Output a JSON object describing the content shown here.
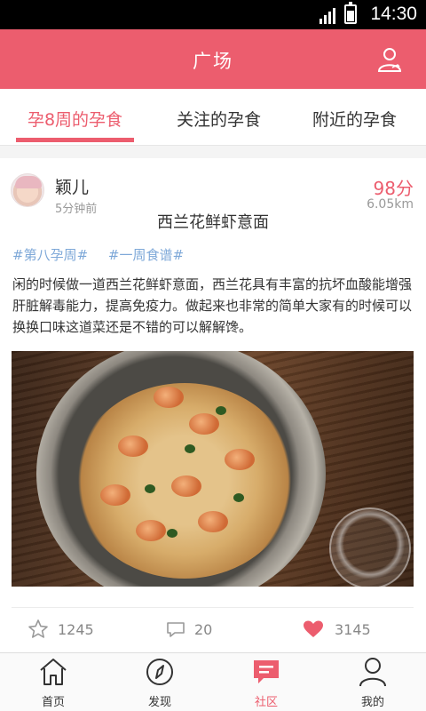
{
  "status_bar": {
    "time": "14:30",
    "icons": [
      "signal-icon",
      "battery-icon"
    ]
  },
  "app_bar": {
    "title": "广场",
    "icons": [
      "user-icon"
    ]
  },
  "tabs": [
    {
      "label": "孕8周的孕食",
      "active": true
    },
    {
      "label": "关注的孕食",
      "active": false
    },
    {
      "label": "附近的孕食",
      "active": false
    }
  ],
  "post": {
    "author": "颖儿",
    "time_ago": "5分钟前",
    "score": "98分",
    "distance": "6.05km",
    "title": "西兰花鲜虾意面",
    "tags": [
      "#第八孕周#",
      "#一周食谱#"
    ],
    "text": "闲的时候做一道西兰花鲜虾意面，西兰花具有丰富的抗坏血酸能增强肝脏解毒能力，提高免疫力。做起来也非常的简单大家有的时候可以换换口味这道菜还是不错的可以解解馋。",
    "image_alt": "shrimp-pasta-photo",
    "actions": {
      "favorites": "1245",
      "comments": "20",
      "likes": "3145"
    }
  },
  "bottom_nav": [
    {
      "label": "首页",
      "icon": "home-icon",
      "active": false
    },
    {
      "label": "发现",
      "icon": "compass-icon",
      "active": false
    },
    {
      "label": "社区",
      "icon": "chat-icon",
      "active": true
    },
    {
      "label": "我的",
      "icon": "person-icon",
      "active": false
    }
  ],
  "colors": {
    "accent": "#ec5d6e",
    "tag": "#7ea8d8",
    "muted": "#999999"
  }
}
